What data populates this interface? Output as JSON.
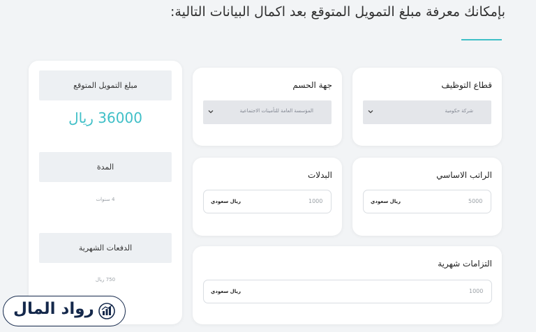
{
  "heading": {
    "text": "بإمكانك معرفة مبلغ التمويل المتوقع بعد اكمال البيانات التالية:"
  },
  "form": {
    "employment_sector": {
      "label": "قطاع التوظيف",
      "selected": "شركة حكومية"
    },
    "deduction_entity": {
      "label": "جهة الحسم",
      "selected": "المؤسسة العامة للتأمينات الاجتماعية"
    },
    "basic_salary": {
      "label": "الراتب الاساسي",
      "value": "5000",
      "unit": "ريال سعودي"
    },
    "allowances": {
      "label": "البدلات",
      "value": "1000",
      "unit": "ريال سعودي"
    },
    "monthly_obligations": {
      "label": "التزامات شهرية",
      "value": "1000",
      "unit": "ريال سعودي"
    }
  },
  "summary": {
    "expected_amount_label": "مبلغ التمويل المتوقع",
    "expected_amount_value": "36000 ريال",
    "duration_label": "المدة",
    "duration_value": "4 سنوات",
    "monthly_payments_label": "الدفعات الشهرية",
    "monthly_payments_value": "750 ريال"
  },
  "logo": {
    "text": "رواد المال",
    "icon": "chart-coin-icon"
  },
  "colors": {
    "accent": "#3fbfc7",
    "brand": "#14284b",
    "background": "#f2f4f6"
  }
}
